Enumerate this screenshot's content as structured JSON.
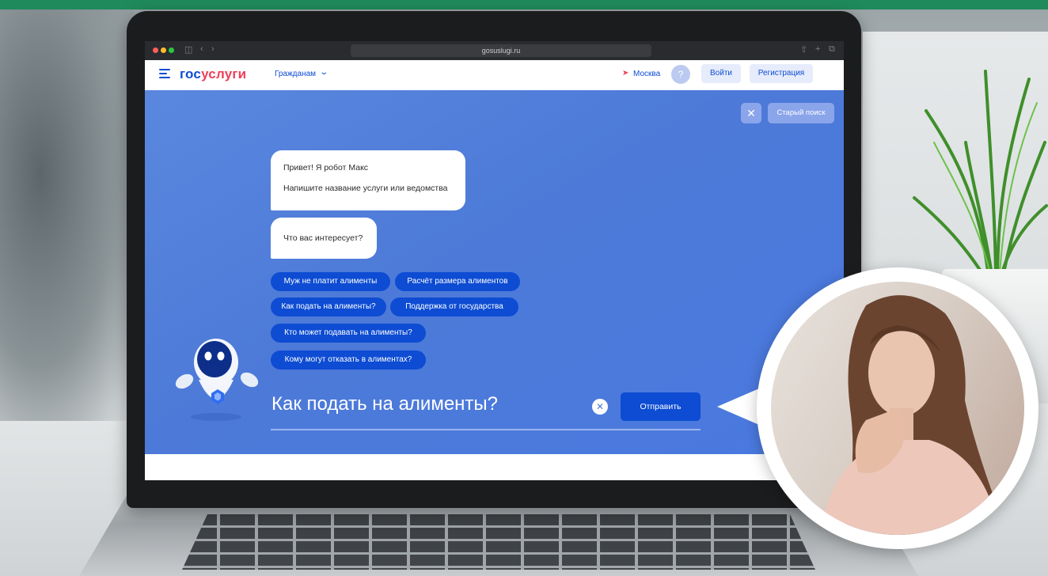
{
  "browser": {
    "url": "gosuslugi.ru",
    "sidebar_glyph": "◫",
    "back_glyph": "‹",
    "forward_glyph": "›",
    "share_glyph": "⇧",
    "newtab_glyph": "+",
    "tabs_glyph": "⧉"
  },
  "header": {
    "logo_part1": "гос",
    "logo_part2": "услуги",
    "nav_citizens": "Гражданам",
    "location": "Москва",
    "help": "?",
    "login": "Войти",
    "register": "Регистрация"
  },
  "chat": {
    "close_glyph": "✕",
    "old_search": "Старый поиск",
    "greeting_line1": "Привет! Я робот Макс",
    "greeting_line2": "Напишите название услуги или ведомства",
    "question": "Что вас интересует?",
    "chips": [
      "Муж не платит алименты",
      "Расчёт размера алиментов",
      "Как подать на алименты?",
      "Поддержка от государства",
      "Кто может подавать на алименты?",
      "Кому могут отказать в алиментах?"
    ],
    "query": "Как подать на алименты?",
    "clear_glyph": "✕",
    "send": "Отправить"
  },
  "colors": {
    "brand_blue": "#0d4cd3",
    "brand_red": "#ee3f58",
    "chat_bg": "#4d7ad8",
    "top_stripe": "#1f8a5b"
  }
}
